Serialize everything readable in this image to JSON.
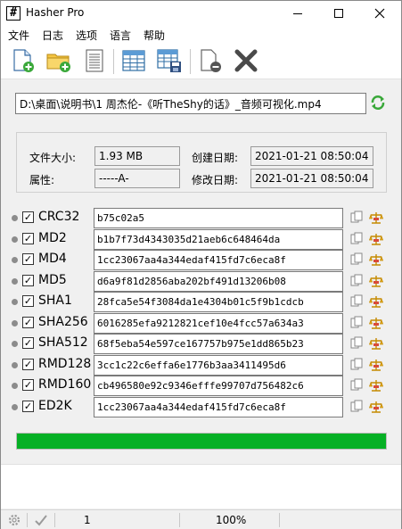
{
  "window": {
    "title": "Hasher Pro",
    "app_icon_glyph": "#"
  },
  "menu": {
    "items": [
      "文件",
      "日志",
      "选项",
      "语言",
      "帮助"
    ]
  },
  "file": {
    "path": "D:\\桌面\\说明书\\1 周杰伦-《听TheShy的话》_音频可视化.mp4"
  },
  "info": {
    "size_label": "文件大小:",
    "size_value": "1.93 MB",
    "attr_label": "属性:",
    "attr_value": "-----A-",
    "created_label": "创建日期:",
    "created_value": "2021-01-21 08:50:04",
    "modified_label": "修改日期:",
    "modified_value": "2021-01-21 08:50:04"
  },
  "hashes": [
    {
      "name": "CRC32",
      "value": "b75c02a5"
    },
    {
      "name": "MD2",
      "value": "b1b7f73d4343035d21aeb6c648464da"
    },
    {
      "name": "MD4",
      "value": "1cc23067aa4a344edaf415fd7c6eca8f"
    },
    {
      "name": "MD5",
      "value": "d6a9f81d2856aba202bf491d13206b08"
    },
    {
      "name": "SHA1",
      "value": "28fca5e54f3084da1e4304b01c5f9b1cdcb"
    },
    {
      "name": "SHA256",
      "value": "6016285efa9212821cef10e4fcc57a634a3"
    },
    {
      "name": "SHA512",
      "value": "68f5eba54e597ce167757b975e1dd865b23"
    },
    {
      "name": "RMD128",
      "value": "3cc1c22c6effa6e1776b3aa3411495d6"
    },
    {
      "name": "RMD160",
      "value": "cb496580e92c9346efffe99707d756482c6"
    },
    {
      "name": "ED2K",
      "value": "1cc23067aa4a344edaf415fd7c6eca8f"
    }
  ],
  "progress": {
    "percent": 100,
    "color": "#06b025"
  },
  "status": {
    "count": "1",
    "zoom": "100%"
  }
}
